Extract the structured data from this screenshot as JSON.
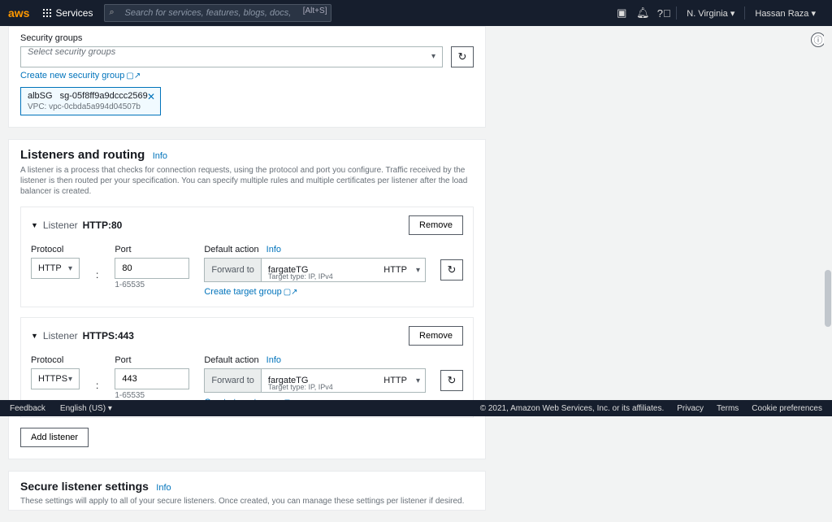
{
  "nav": {
    "logo": "aws",
    "services": "Services",
    "searchPlaceholder": "Search for services, features, blogs, docs, and more",
    "searchKbd": "[Alt+S]",
    "region": "N. Virginia ▾",
    "user": "Hassan Raza ▾"
  },
  "sg": {
    "title": "Security groups",
    "placeholder": "Select security groups",
    "createLink": "Create new security group",
    "token": {
      "name": "albSG",
      "id": "sg-05f8ff9a9dccc2569",
      "vpc": "VPC: vpc-0cbda5a994d04507b"
    }
  },
  "lr": {
    "title": "Listeners and routing",
    "info": "Info",
    "desc": "A listener is a process that checks for connection requests, using the protocol and port you configure. Traffic received by the listener is then routed per your specification. You can specify multiple rules and multiple certificates per listener after the load balancer is created."
  },
  "labels": {
    "listener": "Listener",
    "protocol": "Protocol",
    "port": "Port",
    "portHint": "1-65535",
    "defaultAction": "Default action",
    "info": "Info",
    "forwardTo": "Forward to",
    "targetType": "Target type: IP, IPv4",
    "createTG": "Create target group",
    "remove": "Remove",
    "addListener": "Add listener"
  },
  "listeners": [
    {
      "header": "HTTP:80",
      "protocol": "HTTP",
      "port": "80",
      "tg": "fargateTG",
      "tgProto": "HTTP"
    },
    {
      "header": "HTTPS:443",
      "protocol": "HTTPS",
      "port": "443",
      "tg": "fargateTG",
      "tgProto": "HTTP"
    }
  ],
  "secure": {
    "title": "Secure listener settings",
    "info": "Info",
    "desc": "These settings will apply to all of your secure listeners. Once created, you can manage these settings per listener if desired."
  },
  "footer": {
    "feedback": "Feedback",
    "lang": "English (US) ▾",
    "copyright": "© 2021, Amazon Web Services, Inc. or its affiliates.",
    "privacy": "Privacy",
    "terms": "Terms",
    "cookies": "Cookie preferences"
  }
}
